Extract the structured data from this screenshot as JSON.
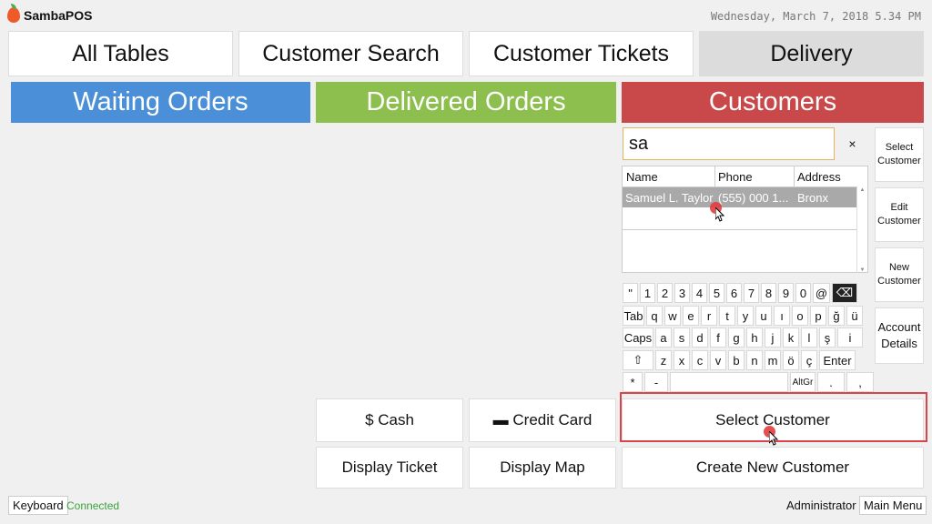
{
  "app": {
    "name": "SambaPOS",
    "datetime": "Wednesday, March 7, 2018 5.34 PM"
  },
  "tabs": [
    {
      "label": "All Tables"
    },
    {
      "label": "Customer Search"
    },
    {
      "label": "Customer Tickets"
    },
    {
      "label": "Delivery"
    }
  ],
  "headers": {
    "waiting": "Waiting Orders",
    "delivered": "Delivered Orders",
    "customers": "Customers"
  },
  "colors": {
    "waiting": "#4a8fd8",
    "delivered": "#8dbf4e",
    "customers": "#c9484a"
  },
  "search": {
    "value": "sa",
    "clear": "×"
  },
  "grid": {
    "columns": [
      "Name",
      "Phone",
      "Address"
    ],
    "rows": [
      {
        "name": "Samuel L. Taylor",
        "phone": "(555) 000 1...",
        "address": "Bronx"
      }
    ]
  },
  "side_buttons": {
    "select": "Select Customer",
    "edit": "Edit Customer",
    "new": "New Customer",
    "account": "Account Details"
  },
  "keyboard": {
    "row1": [
      "\"",
      "1",
      "2",
      "3",
      "4",
      "5",
      "6",
      "7",
      "8",
      "9",
      "0",
      "@",
      "⌫"
    ],
    "row2": [
      "Tab",
      "q",
      "w",
      "e",
      "r",
      "t",
      "y",
      "u",
      "ı",
      "o",
      "p",
      "ğ",
      "ü"
    ],
    "row3": [
      "Caps",
      "a",
      "s",
      "d",
      "f",
      "g",
      "h",
      "j",
      "k",
      "l",
      "ş",
      "i"
    ],
    "row4": [
      "⇧",
      "z",
      "x",
      "c",
      "v",
      "b",
      "n",
      "m",
      "ö",
      "ç",
      "Enter"
    ],
    "row5": [
      "*",
      "-",
      " ",
      "AltGr",
      ".",
      ","
    ]
  },
  "actions": {
    "cash": "$ Cash",
    "credit": "▬ Credit Card",
    "select_customer": "Select Customer",
    "display_ticket": "Display Ticket",
    "display_map": "Display Map",
    "create_customer": "Create New Customer"
  },
  "footer": {
    "keyboard": "Keyboard",
    "status": "Connected",
    "user": "Administrator",
    "main_menu": "Main Menu"
  }
}
